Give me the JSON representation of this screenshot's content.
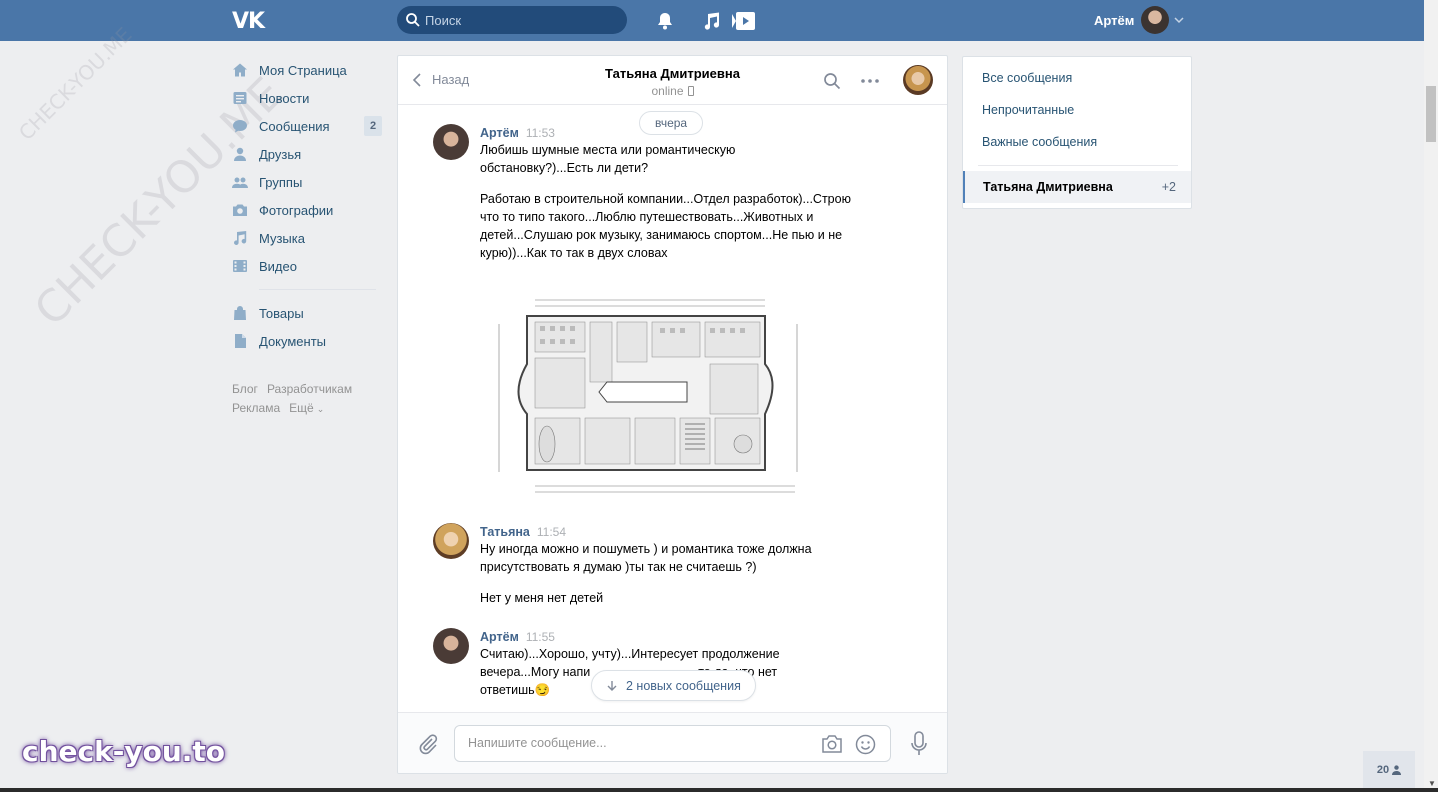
{
  "header": {
    "logo": "VK",
    "search_placeholder": "Поиск",
    "user_name": "Артём"
  },
  "nav": {
    "items": [
      {
        "label": "Моя Страница",
        "icon": "home-icon"
      },
      {
        "label": "Новости",
        "icon": "news-icon"
      },
      {
        "label": "Сообщения",
        "icon": "messages-icon",
        "badge": "2"
      },
      {
        "label": "Друзья",
        "icon": "friends-icon"
      },
      {
        "label": "Группы",
        "icon": "groups-icon"
      },
      {
        "label": "Фотографии",
        "icon": "camera-icon"
      },
      {
        "label": "Музыка",
        "icon": "music-icon"
      },
      {
        "label": "Видео",
        "icon": "video-icon"
      },
      {
        "label": "Товары",
        "icon": "bag-icon"
      },
      {
        "label": "Документы",
        "icon": "document-icon"
      }
    ],
    "footer_links": [
      "Блог",
      "Разработчикам",
      "Реклама",
      "Ещё"
    ]
  },
  "chat": {
    "back_label": "Назад",
    "peer_name": "Татьяна Дмитриевна",
    "peer_status": "online",
    "day_label": "вчера",
    "messages": [
      {
        "author": "Артём",
        "time": "11:53",
        "paragraphs": [
          "Любишь шумные места или романтическую обстановку?)...Есть ли дети?",
          "Работаю в строительной компании...Отдел разработок)...Строю что то типо такого...Люблю путешествовать...Животных и детей...Слушаю рок музыку, занимаюсь спортом...Не пью и не курю))...Как то так в двух словах"
        ]
      },
      {
        "author": "Татьяна",
        "time": "11:54",
        "paragraphs": [
          "Ну иногда можно и пошуметь ) и романтика тоже должна присутствовать я думаю )ты так не считаешь ?)",
          "Нет у меня нет детей"
        ]
      },
      {
        "author": "Артём",
        "time": "11:55",
        "paragraphs": [
          "Считаю)...Хорошо, учту)...Интересует продолжение вечера...Могу напи",
          "то да, что нет",
          "ответишь😏"
        ]
      }
    ],
    "new_messages_label": "2 новых сообщения",
    "composer_placeholder": "Напишите сообщение..."
  },
  "right_menu": {
    "items": [
      "Все сообщения",
      "Непрочитанные",
      "Важные сообщения"
    ],
    "active_name": "Татьяна Дмитриевна",
    "active_count": "+2"
  },
  "watermarks": {
    "big": "CHECK-YOU.ME",
    "small": "CHECK-YOU.ME",
    "brand": "check-you.to"
  },
  "online_count": "20",
  "colors": {
    "header": "#4a76a8",
    "link": "#42648b",
    "background": "#edeef0"
  }
}
